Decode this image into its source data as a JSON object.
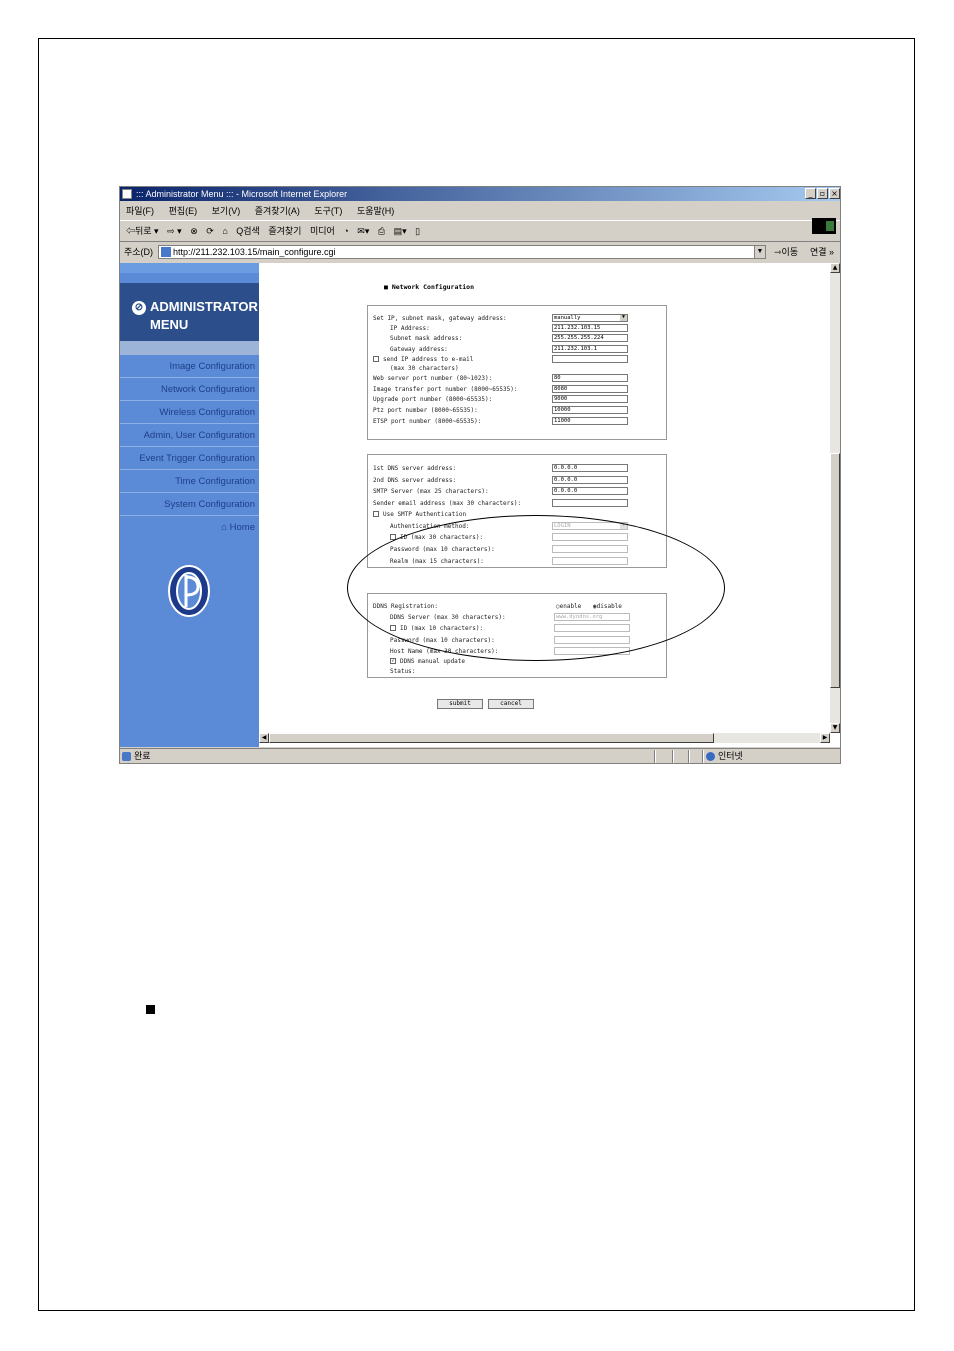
{
  "window": {
    "title": "::: Administrator Menu ::: - Microsoft Internet Explorer",
    "menu": [
      "파일(F)",
      "편집(E)",
      "보기(V)",
      "즐겨찾기(A)",
      "도구(T)",
      "도움말(H)"
    ],
    "toolbar": [
      "⇦뒤로 ▾",
      "⇨ ▾",
      "⊗",
      "⟳",
      "⌂",
      "Q검색",
      "즐겨찾기",
      "미디어",
      "◔",
      "✉▾",
      "⎙",
      "▤▾",
      "▯"
    ],
    "address_label": "주소(D)",
    "address_url": "http://211.232.103.15/main_configure.cgi",
    "go_label": "이동",
    "links_label": "연결 »",
    "status_text": "완료",
    "zone_text": "인터넷"
  },
  "sidebar": {
    "title_line1": "ADMINISTRATOR",
    "title_line2": "MENU",
    "items": [
      {
        "label": "Image Configuration"
      },
      {
        "label": "Network Configuration"
      },
      {
        "label": "Wireless Configuration"
      },
      {
        "label": "Admin, User Configuration"
      },
      {
        "label": "Event Trigger Configuration"
      },
      {
        "label": "Time Configuration"
      },
      {
        "label": "System Configuration"
      },
      {
        "label": "Home"
      }
    ]
  },
  "form": {
    "section_title": "■ Network Configuration",
    "ip_mode_label": "Set IP, subnet mask, gateway address:",
    "ip_mode_value": "manually",
    "ip_label": "IP Address:",
    "ip_value": "211.232.103.15",
    "subnet_label": "Subnet mask address:",
    "subnet_value": "255.255.255.224",
    "gateway_label": "Gateway address:",
    "gateway_value": "211.232.103.1",
    "send_ip_label": "send IP address to e-mail",
    "send_ip_sub": "(max 30 characters)",
    "web_port_label": "Web server port number (80~1023):",
    "web_port_value": "80",
    "img_port_label": "Image transfer port number (8000~65535):",
    "img_port_value": "8080",
    "upg_port_label": "Upgrade port number (8000~65535):",
    "upg_port_value": "9000",
    "ptz_port_label": "Ptz port number (8000~65535):",
    "ptz_port_value": "10000",
    "etsp_port_label": "ETSP port number (8000~65535):",
    "etsp_port_value": "11000",
    "dns1_label": "1st DNS server address:",
    "dns1_value": "0.0.0.0",
    "dns2_label": "2nd DNS server address:",
    "dns2_value": "0.0.0.0",
    "smtp_label": "SMTP Server (max 25 characters):",
    "smtp_value": "0.0.0.0",
    "sender_label": "Sender email address (max 30 characters):",
    "sender_value": "",
    "use_smtp_label": "Use SMTP Authentication",
    "auth_method_label": "Authentication method:",
    "auth_method_value": "LOGIN",
    "auth_id_label": "ID (max 30 characters):",
    "auth_pw_label": "Password (max 10 characters):",
    "realm_label": "Realm (max 15 characters):",
    "ddns_label": "DDNS Registration:",
    "ddns_enable": "enable",
    "ddns_disable": "disable",
    "ddns_server_label": "DDNS Server (max 30 characters):",
    "ddns_server_value": "www.dyndns.org",
    "ddns_id_label": "ID (max 10 characters):",
    "ddns_pw_label": "Password (max 10 characters):",
    "host_label": "Host Name (max 30 characters):",
    "ddns_manual_label": "DDNS manual update",
    "status_label": "Status:",
    "submit_label": "submit",
    "cancel_label": "cancel"
  }
}
